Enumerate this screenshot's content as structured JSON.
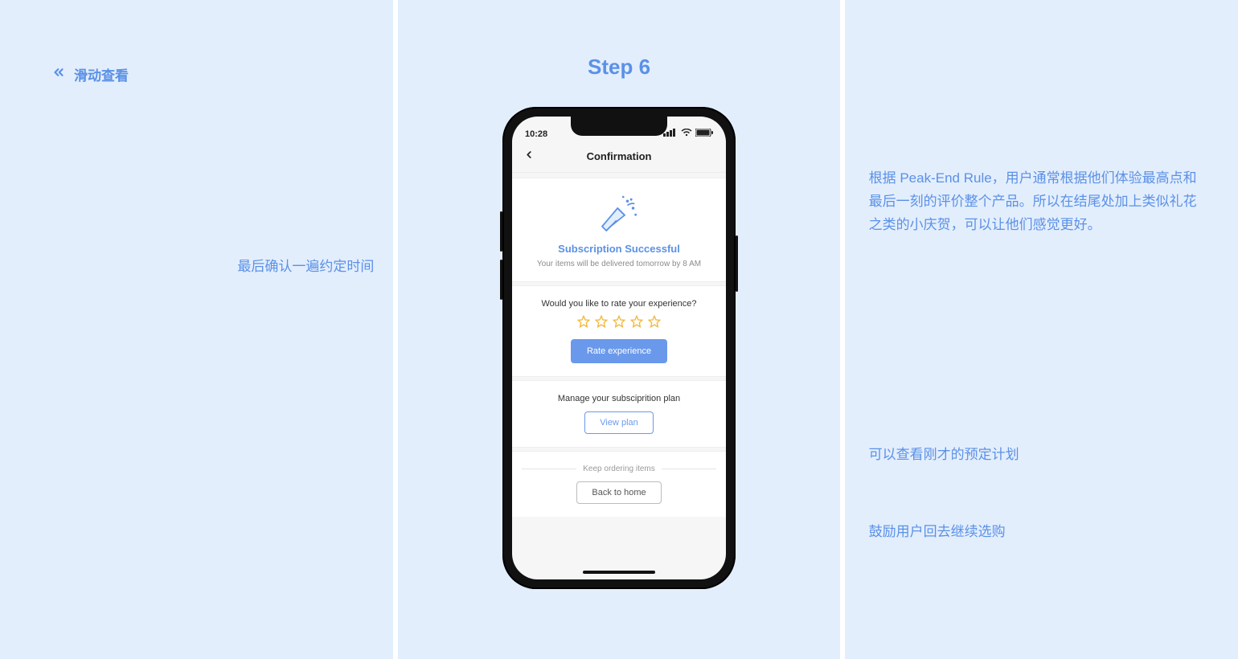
{
  "header": {
    "swipe_label": "滑动查看",
    "step_title": "Step 6"
  },
  "phone": {
    "statusbar": {
      "time": "10:28"
    },
    "topbar": {
      "title": "Confirmation"
    },
    "success": {
      "title": "Subscription Successful",
      "subtitle": "Your items will be delivered tomorrow by 8 AM"
    },
    "rate": {
      "question": "Would you like to rate your experience?",
      "button": "Rate experience"
    },
    "manage": {
      "title": "Manage your subsciprition plan",
      "button": "View plan"
    },
    "keep": {
      "label": "Keep ordering items",
      "button": "Back to home"
    }
  },
  "annotations": {
    "left_1": "最后确认一遍约定时间",
    "right_1": "根据 Peak-End Rule，用户通常根据他们体验最高点和最后一刻的评价整个产品。所以在结尾处加上类似礼花之类的小庆贺，可以让他们感觉更好。",
    "right_2": "可以查看刚才的预定计划",
    "right_3": "鼓励用户回去继续选购"
  },
  "colors": {
    "accent": "#5b91e6",
    "button": "#6a99ec",
    "star": "#f2b63c",
    "panel_bg": "#e3eefd"
  }
}
